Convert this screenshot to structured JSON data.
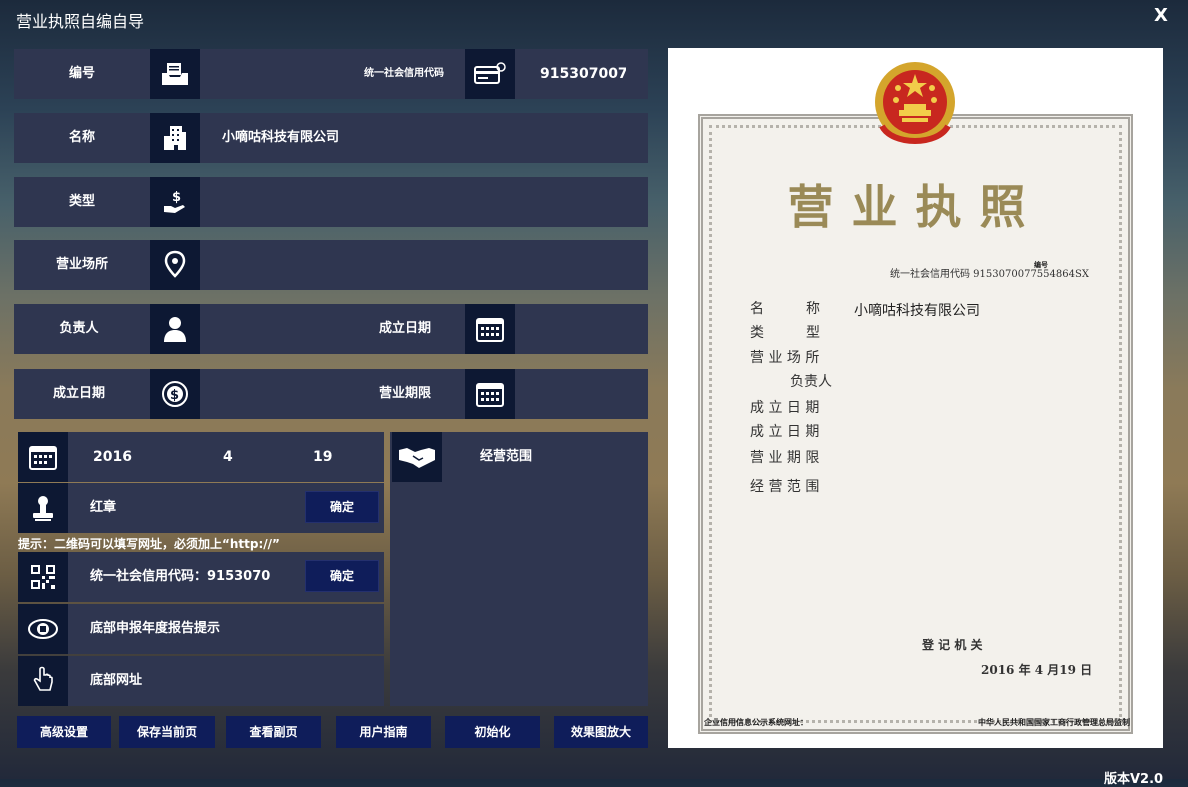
{
  "window": {
    "title": "营业执照自编自导",
    "close_label": "X"
  },
  "form": {
    "number": {
      "label": "编号",
      "credit_label": "统一社会信用代码",
      "credit_value": "9153070077"
    },
    "name": {
      "label": "名称",
      "value": "小嘀咕科技有限公司"
    },
    "type": {
      "label": "类型",
      "value": ""
    },
    "address": {
      "label": "营业场所",
      "value": ""
    },
    "owner": {
      "label": "负责人",
      "value": "",
      "date_label": "成立日期"
    },
    "founded": {
      "label": "成立日期",
      "value": "",
      "period_label": "营业期限"
    }
  },
  "date_row": {
    "year": "2016",
    "month": "4",
    "day": "19"
  },
  "stamp_row": {
    "label": "红章",
    "confirm": "确定"
  },
  "hint": "提示：二维码可以填写网址，必须加上“http://”",
  "qr_row": {
    "label": "统一社会信用代码：9153070",
    "confirm": "确定"
  },
  "report_row": {
    "label": "底部申报年度报告提示"
  },
  "url_row": {
    "label": "底部网址"
  },
  "scope": {
    "label": "经营范围"
  },
  "buttons": [
    "高级设置",
    "保存当前页",
    "查看副页",
    "用户指南",
    "初始化",
    "效果图放大"
  ],
  "certificate": {
    "title": "营业执照",
    "credit_line": "统一社会信用代码 9153070077554864SX",
    "serial_label": "编号",
    "fields": [
      {
        "label": "名　　　称",
        "value": "小嘀咕科技有限公司"
      },
      {
        "label": "类　　　型",
        "value": ""
      },
      {
        "label": "营 业 场 所",
        "value": ""
      },
      {
        "label": "负责人",
        "value": ""
      },
      {
        "label": "成 立 日 期",
        "value": ""
      },
      {
        "label": "成 立 日 期",
        "value": ""
      },
      {
        "label": "营 业 期 限",
        "value": ""
      },
      {
        "label": "经 营 范 围",
        "value": ""
      }
    ],
    "registrar": "登 记 机 关",
    "issue_date": "2016 年  4  月19 日",
    "bottom_left": "企业信用信息公示系统网址：",
    "bottom_right": "中华人民共和国国家工商行政管理总局监制"
  },
  "version": "版本V2.0"
}
